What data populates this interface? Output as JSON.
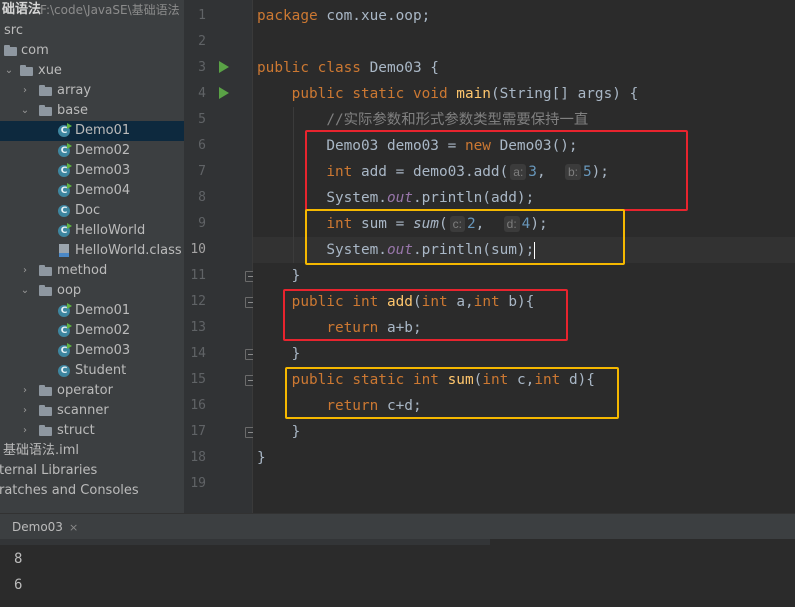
{
  "project": {
    "root_name": "础语法",
    "root_path": "F:\\code\\JavaSE\\基础语法",
    "items": [
      {
        "label": "src",
        "icon": "source-folder-icon"
      },
      {
        "label": "com",
        "icon": "package-icon"
      },
      {
        "label": "xue",
        "icon": "package-icon"
      },
      {
        "label": "array",
        "icon": "package-icon"
      },
      {
        "label": "base",
        "icon": "package-icon"
      },
      {
        "label": "Demo01",
        "icon": "java-class-icon"
      },
      {
        "label": "Demo02",
        "icon": "java-class-icon"
      },
      {
        "label": "Demo03",
        "icon": "java-class-icon"
      },
      {
        "label": "Demo04",
        "icon": "java-class-icon"
      },
      {
        "label": "Doc",
        "icon": "java-class-icon"
      },
      {
        "label": "HelloWorld",
        "icon": "java-class-icon"
      },
      {
        "label": "HelloWorld.class",
        "icon": "class-file-icon"
      },
      {
        "label": "method",
        "icon": "package-icon"
      },
      {
        "label": "oop",
        "icon": "package-icon"
      },
      {
        "label": "Demo01",
        "icon": "java-class-icon"
      },
      {
        "label": "Demo02",
        "icon": "java-class-icon"
      },
      {
        "label": "Demo03",
        "icon": "java-class-icon"
      },
      {
        "label": "Student",
        "icon": "java-class-icon"
      },
      {
        "label": "operator",
        "icon": "package-icon"
      },
      {
        "label": "scanner",
        "icon": "package-icon"
      },
      {
        "label": "struct",
        "icon": "package-icon"
      },
      {
        "label": "基础语法.iml",
        "icon": "module-file-icon"
      },
      {
        "label": "ternal Libraries",
        "icon": "library-icon"
      },
      {
        "label": "ratches and Consoles",
        "icon": "scratch-icon"
      }
    ],
    "selected_index": 5
  },
  "gutter": {
    "line_numbers": [
      "1",
      "2",
      "3",
      "4",
      "5",
      "6",
      "7",
      "8",
      "9",
      "10",
      "11",
      "12",
      "13",
      "14",
      "15",
      "16",
      "17",
      "18",
      "19"
    ]
  },
  "code": {
    "package_kw": "package",
    "package_name": " com.xue.oop;",
    "public_kw": "public",
    "class_kw": "class",
    "static_kw": "static",
    "void_kw": "void",
    "int_kw": "int",
    "new_kw": "new",
    "return_kw": "return",
    "class_name": " Demo03 {",
    "main_name": "main",
    "main_params": "(String[] args) {",
    "comment": "//实际参数和形式参数类型需要保持一直",
    "l6_a": "Demo03 demo03 = ",
    "l6_b": " Demo03();",
    "l7_a": " add = demo03.add(",
    "hint_a": "a:",
    "hint_b": "b:",
    "hint_c": "c:",
    "hint_d": "d:",
    "val_3": "3",
    "val_5": "5",
    "val_2": "2",
    "val_4": "4",
    "comma_sp": ",  ",
    "close_paren_semi": ");",
    "sys": "System.",
    "out": "out",
    "println_add": ".println(add);",
    "println_sum": ".println(sum);",
    "l9_a": " sum = ",
    "sum_call": "sum",
    "paren_open": "(",
    "brace_close": "}",
    "add_name": "add",
    "add_params_a": "(",
    "add_params_b": " a,",
    "add_params_c": " b){",
    "ret_add": " a+b;",
    "sum_name": "sum",
    "sum_params_b": " c,",
    "sum_params_c": " d){",
    "ret_sum": " c+d;"
  },
  "run_panel": {
    "tab_label": "Demo03",
    "close_glyph": "×",
    "output": [
      "8",
      "6"
    ]
  },
  "colors": {
    "annotation_red": "#e8242e",
    "annotation_yellow": "#f5b800",
    "keyword": "#cc7832",
    "method": "#ffc66d",
    "number": "#6897bb"
  }
}
